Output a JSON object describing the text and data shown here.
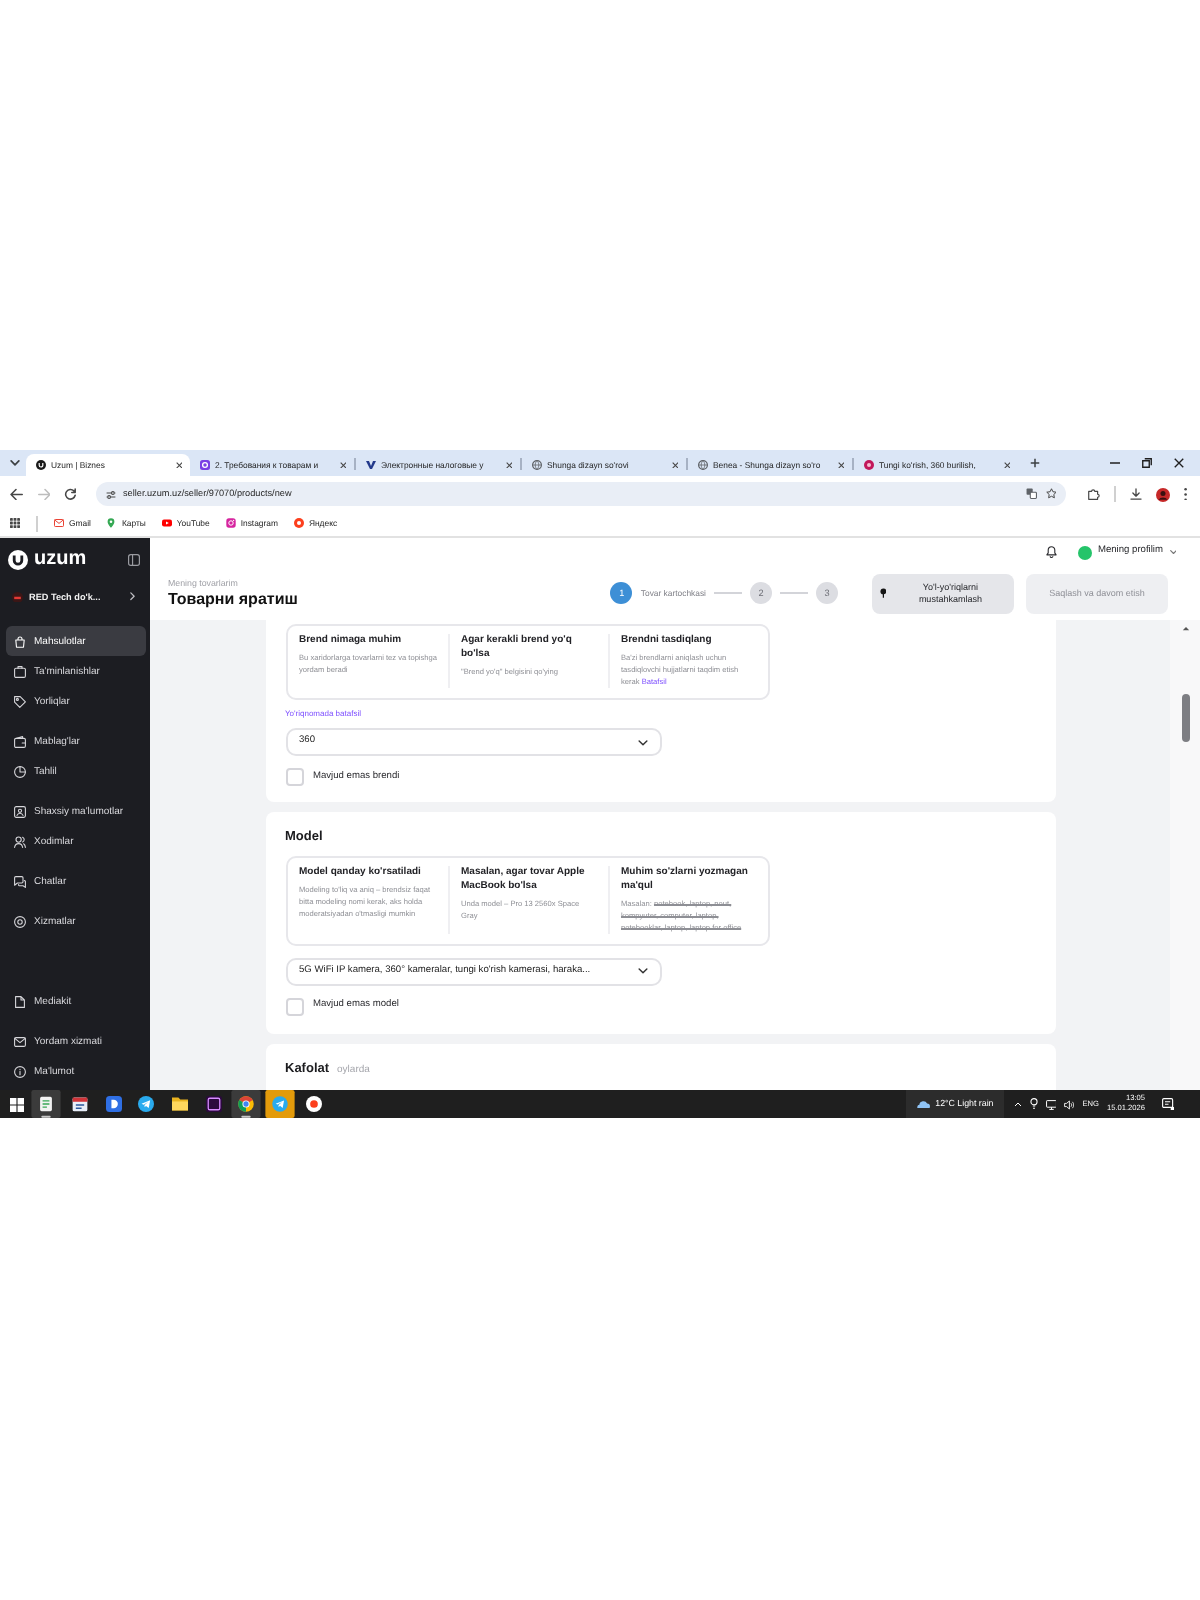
{
  "browser": {
    "tabs": [
      {
        "title": "Uzum | Biznes",
        "selected": true
      },
      {
        "title": "2. Требования к товарам и",
        "selected": false
      },
      {
        "title": "Электронные налоговые у",
        "selected": false
      },
      {
        "title": "Shunga dizayn so'rovi",
        "selected": false
      },
      {
        "title": "Benea - Shunga dizayn so'ro",
        "selected": false
      },
      {
        "title": "Tungi ko'rish, 360 burilish,",
        "selected": false
      }
    ],
    "forward": {
      "disabled": true
    },
    "address": "seller.uzum.uz/seller/97070/products/new",
    "bookmarks": [
      "Gmail",
      "Карты",
      "YouTube",
      "Instagram",
      "Яндекс"
    ]
  },
  "sidebar": {
    "logo": "uzum",
    "shop": "RED Tech do'k...",
    "groups": [
      [
        {
          "label": "Mahsulotlar",
          "selected": true
        },
        {
          "label": "Ta'minlanishlar",
          "selected": false
        },
        {
          "label": "Yorliqlar",
          "selected": false
        }
      ],
      [
        {
          "label": "Mablag'lar",
          "selected": false
        },
        {
          "label": "Tahlil",
          "selected": false
        }
      ],
      [
        {
          "label": "Shaxsiy ma'lumotlar",
          "selected": false
        },
        {
          "label": "Xodimlar",
          "selected": false
        }
      ],
      [
        {
          "label": "Chatlar",
          "selected": false
        }
      ],
      [
        {
          "label": "Xizmatlar",
          "selected": false
        }
      ]
    ],
    "bottom_groups": [
      [
        {
          "label": "Mediakit",
          "selected": false
        }
      ],
      [
        {
          "label": "Yordam xizmati",
          "selected": false
        },
        {
          "label": "Ma'lumot",
          "selected": false
        }
      ]
    ]
  },
  "topbar": {
    "profile": "Mening profilim"
  },
  "header": {
    "breadcrumb": "Mening tovarlarim",
    "title": "Товарни яратиш",
    "steps": [
      {
        "number": "1",
        "label": "Tovar kartochkasi",
        "selected": true
      },
      {
        "number": "2",
        "selected": false
      },
      {
        "number": "3",
        "selected": false
      }
    ],
    "buttons": [
      {
        "label": "Yo'l-yo'riqlarni mustahkamlash",
        "disabled": false
      },
      {
        "label": "Saqlash va davom etish",
        "disabled": true
      }
    ]
  },
  "sections": [
    {
      "tips": [
        {
          "title": "Brend nimaga muhim",
          "text": "Bu xaridorlarga tovarlarni tez va topishga yordam beradi"
        },
        {
          "title": "Agar kerakli brend yo'q bo'lsa",
          "text": "\"Brend yo'q\" belgisini qo'ying"
        },
        {
          "title": "Brendni tasdiqlang",
          "text": "Ba'zi brendlarni aniqlash uchun tasdiqlovchi hujjatlarni taqdim etish kerak",
          "link": "Batafsil"
        }
      ],
      "link": "Yo'riqnomada batafsil",
      "select": "360",
      "checkbox": {
        "label": "Mavjud emas brendi",
        "checked": false
      }
    },
    {
      "title": "Model",
      "tips": [
        {
          "title": "Model qanday ko'rsatiladi",
          "text": "Modeling to'liq va aniq – brendsiz faqat bitta modeling nomi kerak, aks holda moderatsiyadan o'tmasligi mumkin"
        },
        {
          "title": "Masalan, agar tovar Apple MacBook bo'lsa",
          "text": "Unda model – Pro 13 2560x Space Gray"
        },
        {
          "title": "Muhim so'zlarni yozmagan ma'qul",
          "text": "Masalan:",
          "struck": "notebook, laptop, nout, kompyuter, computer, laptop, notebooklar, laptop, laptop for office"
        }
      ],
      "select": "5G WiFi IP kamera, 360° kameralar, tungi ko'rish kamerasi, haraka...",
      "checkbox": {
        "label": "Mavjud emas model",
        "checked": false
      }
    },
    {
      "title": "Kafolat",
      "hint": "oylarda"
    }
  ],
  "taskbar": {
    "apps": [
      {
        "selected": true,
        "flashing": false
      },
      {
        "selected": false,
        "flashing": false
      },
      {
        "selected": false,
        "flashing": false
      },
      {
        "selected": false,
        "flashing": false
      },
      {
        "selected": false,
        "flashing": false
      },
      {
        "selected": false,
        "flashing": false
      },
      {
        "selected": true,
        "flashing": false
      },
      {
        "selected": false,
        "flashing": true
      },
      {
        "selected": false,
        "flashing": false
      }
    ],
    "weather": {
      "temperature": "12°C",
      "condition": "Light rain"
    },
    "language": "ENG",
    "time": "13:05",
    "date": "15.01.2026"
  }
}
